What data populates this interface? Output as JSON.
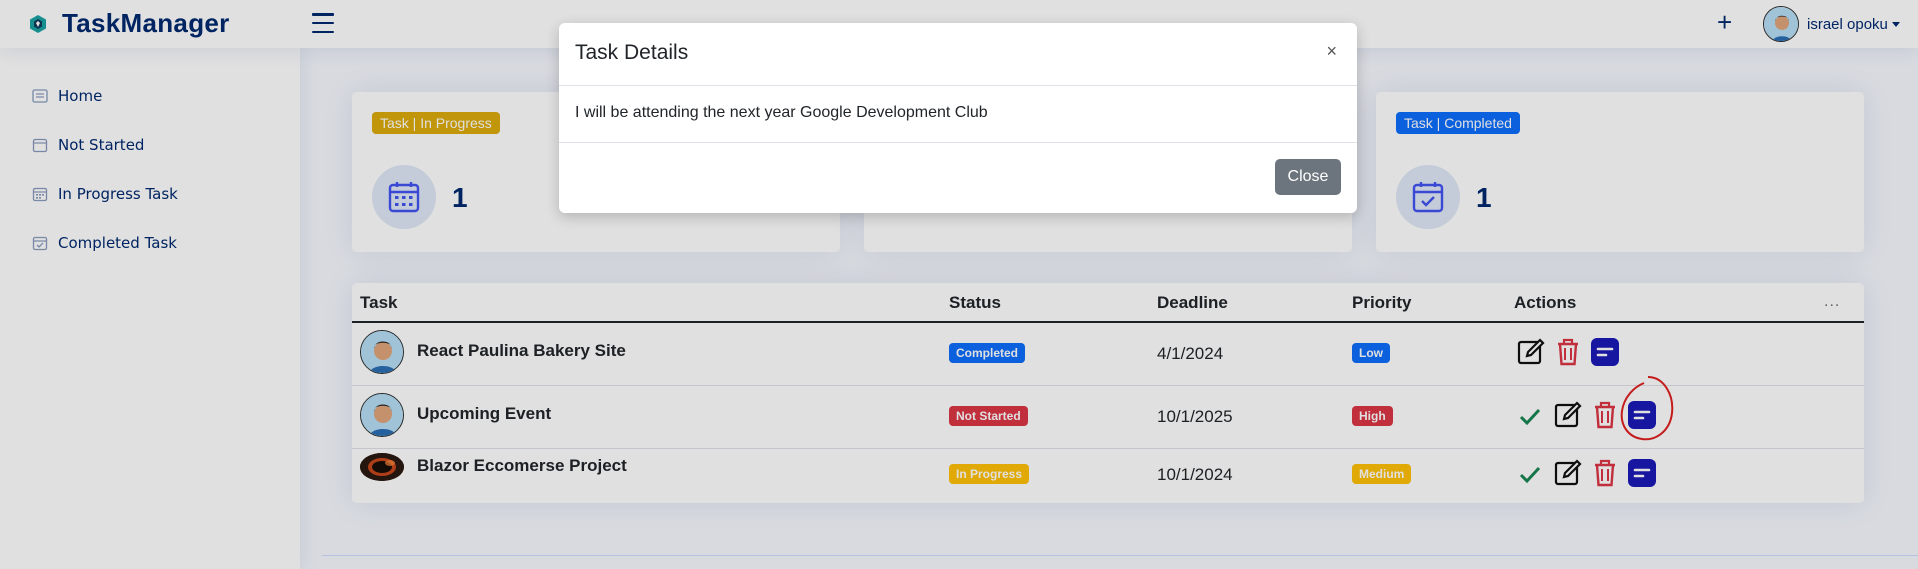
{
  "header": {
    "app_name": "TaskManager",
    "user_name": "israel opoku",
    "add_label": "+"
  },
  "sidebar": {
    "items": [
      {
        "label": "Home",
        "icon": "grid-icon"
      },
      {
        "label": "Not Started",
        "icon": "calendar-icon"
      },
      {
        "label": "In Progress Task",
        "icon": "calendar-grid-icon"
      },
      {
        "label": "Completed Task",
        "icon": "calendar-check-icon"
      }
    ]
  },
  "cards": [
    {
      "badge": "Task | In Progress",
      "badge_color": "#dcab0d",
      "count": "1",
      "icon": "calendar-grid-icon"
    },
    {
      "badge": "Task | Completed",
      "badge_color": "#0d6efd",
      "count": "1",
      "icon": "calendar-check-icon"
    }
  ],
  "table": {
    "headers": {
      "task": "Task",
      "status": "Status",
      "deadline": "Deadline",
      "priority": "Priority",
      "actions": "Actions"
    },
    "more": "...",
    "rows": [
      {
        "task": "React Paulina Bakery Site",
        "status": "Completed",
        "status_color": "#0d6efd",
        "deadline": "4/1/2024",
        "priority": "Low",
        "priority_color": "#0d6efd",
        "avatar": "person-avatar",
        "actions": [
          "edit-icon",
          "trash-icon",
          "details-icon"
        ]
      },
      {
        "task": "Upcoming Event",
        "status": "Not Started",
        "status_color": "#dc3545",
        "deadline": "10/1/2025",
        "priority": "High",
        "priority_color": "#dc3545",
        "avatar": "person-avatar",
        "actions": [
          "check-icon",
          "edit-icon",
          "trash-icon",
          "details-icon"
        ]
      },
      {
        "task": "Blazor Eccomerse Project",
        "status": "In Progress",
        "status_color": "#ffc107",
        "deadline": "10/1/2024",
        "priority": "Medium",
        "priority_color": "#ffc107",
        "avatar": "eclipse-avatar",
        "actions": [
          "check-icon",
          "edit-icon",
          "trash-icon",
          "details-icon"
        ]
      }
    ]
  },
  "modal": {
    "title": "Task Details",
    "close_x": "×",
    "body": "I will be attending the next year Google Development Club",
    "close_button": "Close"
  },
  "colors": {
    "brand": "#012970",
    "accent_blue": "#0d6efd",
    "danger": "#dc3545",
    "success": "#198754",
    "details_button": "#1a1ab8",
    "annotation": "#e02020"
  }
}
